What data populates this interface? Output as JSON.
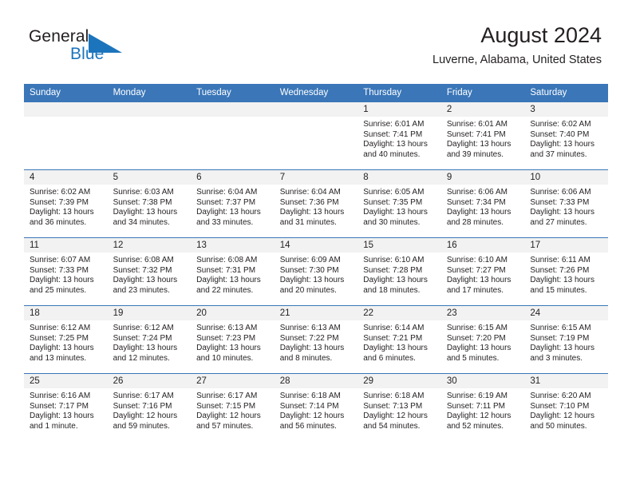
{
  "brand": {
    "name_part1": "General",
    "name_part2": "Blue",
    "accent_color": "#1c75bc",
    "triangle_icon": "triangle-icon"
  },
  "header": {
    "title": "August 2024",
    "subtitle": "Luverne, Alabama, United States",
    "header_bg_color": "#3a76b8"
  },
  "weekdays": [
    "Sunday",
    "Monday",
    "Tuesday",
    "Wednesday",
    "Thursday",
    "Friday",
    "Saturday"
  ],
  "weeks": [
    [
      {
        "day": "",
        "empty": true
      },
      {
        "day": "",
        "empty": true
      },
      {
        "day": "",
        "empty": true
      },
      {
        "day": "",
        "empty": true
      },
      {
        "day": "1",
        "sunrise": "Sunrise: 6:01 AM",
        "sunset": "Sunset: 7:41 PM",
        "daylight1": "Daylight: 13 hours",
        "daylight2": "and 40 minutes."
      },
      {
        "day": "2",
        "sunrise": "Sunrise: 6:01 AM",
        "sunset": "Sunset: 7:41 PM",
        "daylight1": "Daylight: 13 hours",
        "daylight2": "and 39 minutes."
      },
      {
        "day": "3",
        "sunrise": "Sunrise: 6:02 AM",
        "sunset": "Sunset: 7:40 PM",
        "daylight1": "Daylight: 13 hours",
        "daylight2": "and 37 minutes."
      }
    ],
    [
      {
        "day": "4",
        "sunrise": "Sunrise: 6:02 AM",
        "sunset": "Sunset: 7:39 PM",
        "daylight1": "Daylight: 13 hours",
        "daylight2": "and 36 minutes."
      },
      {
        "day": "5",
        "sunrise": "Sunrise: 6:03 AM",
        "sunset": "Sunset: 7:38 PM",
        "daylight1": "Daylight: 13 hours",
        "daylight2": "and 34 minutes."
      },
      {
        "day": "6",
        "sunrise": "Sunrise: 6:04 AM",
        "sunset": "Sunset: 7:37 PM",
        "daylight1": "Daylight: 13 hours",
        "daylight2": "and 33 minutes."
      },
      {
        "day": "7",
        "sunrise": "Sunrise: 6:04 AM",
        "sunset": "Sunset: 7:36 PM",
        "daylight1": "Daylight: 13 hours",
        "daylight2": "and 31 minutes."
      },
      {
        "day": "8",
        "sunrise": "Sunrise: 6:05 AM",
        "sunset": "Sunset: 7:35 PM",
        "daylight1": "Daylight: 13 hours",
        "daylight2": "and 30 minutes."
      },
      {
        "day": "9",
        "sunrise": "Sunrise: 6:06 AM",
        "sunset": "Sunset: 7:34 PM",
        "daylight1": "Daylight: 13 hours",
        "daylight2": "and 28 minutes."
      },
      {
        "day": "10",
        "sunrise": "Sunrise: 6:06 AM",
        "sunset": "Sunset: 7:33 PM",
        "daylight1": "Daylight: 13 hours",
        "daylight2": "and 27 minutes."
      }
    ],
    [
      {
        "day": "11",
        "sunrise": "Sunrise: 6:07 AM",
        "sunset": "Sunset: 7:33 PM",
        "daylight1": "Daylight: 13 hours",
        "daylight2": "and 25 minutes."
      },
      {
        "day": "12",
        "sunrise": "Sunrise: 6:08 AM",
        "sunset": "Sunset: 7:32 PM",
        "daylight1": "Daylight: 13 hours",
        "daylight2": "and 23 minutes."
      },
      {
        "day": "13",
        "sunrise": "Sunrise: 6:08 AM",
        "sunset": "Sunset: 7:31 PM",
        "daylight1": "Daylight: 13 hours",
        "daylight2": "and 22 minutes."
      },
      {
        "day": "14",
        "sunrise": "Sunrise: 6:09 AM",
        "sunset": "Sunset: 7:30 PM",
        "daylight1": "Daylight: 13 hours",
        "daylight2": "and 20 minutes."
      },
      {
        "day": "15",
        "sunrise": "Sunrise: 6:10 AM",
        "sunset": "Sunset: 7:28 PM",
        "daylight1": "Daylight: 13 hours",
        "daylight2": "and 18 minutes."
      },
      {
        "day": "16",
        "sunrise": "Sunrise: 6:10 AM",
        "sunset": "Sunset: 7:27 PM",
        "daylight1": "Daylight: 13 hours",
        "daylight2": "and 17 minutes."
      },
      {
        "day": "17",
        "sunrise": "Sunrise: 6:11 AM",
        "sunset": "Sunset: 7:26 PM",
        "daylight1": "Daylight: 13 hours",
        "daylight2": "and 15 minutes."
      }
    ],
    [
      {
        "day": "18",
        "sunrise": "Sunrise: 6:12 AM",
        "sunset": "Sunset: 7:25 PM",
        "daylight1": "Daylight: 13 hours",
        "daylight2": "and 13 minutes."
      },
      {
        "day": "19",
        "sunrise": "Sunrise: 6:12 AM",
        "sunset": "Sunset: 7:24 PM",
        "daylight1": "Daylight: 13 hours",
        "daylight2": "and 12 minutes."
      },
      {
        "day": "20",
        "sunrise": "Sunrise: 6:13 AM",
        "sunset": "Sunset: 7:23 PM",
        "daylight1": "Daylight: 13 hours",
        "daylight2": "and 10 minutes."
      },
      {
        "day": "21",
        "sunrise": "Sunrise: 6:13 AM",
        "sunset": "Sunset: 7:22 PM",
        "daylight1": "Daylight: 13 hours",
        "daylight2": "and 8 minutes."
      },
      {
        "day": "22",
        "sunrise": "Sunrise: 6:14 AM",
        "sunset": "Sunset: 7:21 PM",
        "daylight1": "Daylight: 13 hours",
        "daylight2": "and 6 minutes."
      },
      {
        "day": "23",
        "sunrise": "Sunrise: 6:15 AM",
        "sunset": "Sunset: 7:20 PM",
        "daylight1": "Daylight: 13 hours",
        "daylight2": "and 5 minutes."
      },
      {
        "day": "24",
        "sunrise": "Sunrise: 6:15 AM",
        "sunset": "Sunset: 7:19 PM",
        "daylight1": "Daylight: 13 hours",
        "daylight2": "and 3 minutes."
      }
    ],
    [
      {
        "day": "25",
        "sunrise": "Sunrise: 6:16 AM",
        "sunset": "Sunset: 7:17 PM",
        "daylight1": "Daylight: 13 hours",
        "daylight2": "and 1 minute."
      },
      {
        "day": "26",
        "sunrise": "Sunrise: 6:17 AM",
        "sunset": "Sunset: 7:16 PM",
        "daylight1": "Daylight: 12 hours",
        "daylight2": "and 59 minutes."
      },
      {
        "day": "27",
        "sunrise": "Sunrise: 6:17 AM",
        "sunset": "Sunset: 7:15 PM",
        "daylight1": "Daylight: 12 hours",
        "daylight2": "and 57 minutes."
      },
      {
        "day": "28",
        "sunrise": "Sunrise: 6:18 AM",
        "sunset": "Sunset: 7:14 PM",
        "daylight1": "Daylight: 12 hours",
        "daylight2": "and 56 minutes."
      },
      {
        "day": "29",
        "sunrise": "Sunrise: 6:18 AM",
        "sunset": "Sunset: 7:13 PM",
        "daylight1": "Daylight: 12 hours",
        "daylight2": "and 54 minutes."
      },
      {
        "day": "30",
        "sunrise": "Sunrise: 6:19 AM",
        "sunset": "Sunset: 7:11 PM",
        "daylight1": "Daylight: 12 hours",
        "daylight2": "and 52 minutes."
      },
      {
        "day": "31",
        "sunrise": "Sunrise: 6:20 AM",
        "sunset": "Sunset: 7:10 PM",
        "daylight1": "Daylight: 12 hours",
        "daylight2": "and 50 minutes."
      }
    ]
  ]
}
